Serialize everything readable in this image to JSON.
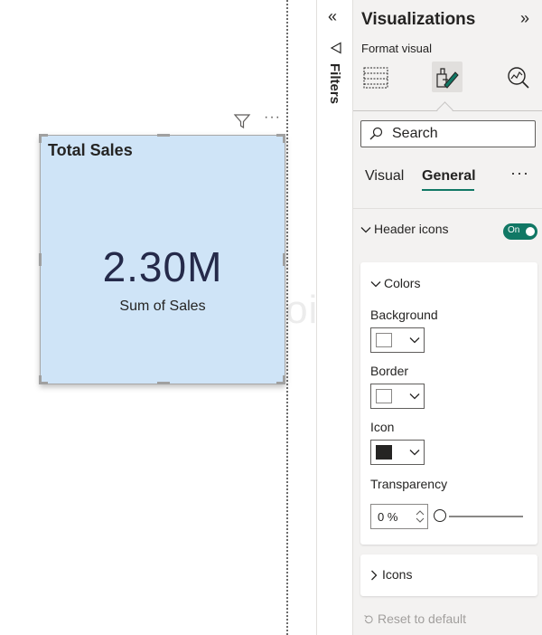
{
  "canvas": {
    "watermark": "javaTpoint",
    "card": {
      "title": "Total Sales",
      "value": "2.30M",
      "label": "Sum of Sales",
      "background": "#cfe4f7"
    },
    "header_icons": {
      "more": "···"
    }
  },
  "filters": {
    "collapse": "«",
    "label": "Filters"
  },
  "visualizations": {
    "title": "Visualizations",
    "expand": "»",
    "subtitle": "Format visual",
    "format_icons": [
      "build-visual-icon",
      "format-visual-icon",
      "analytics-icon"
    ],
    "search": {
      "placeholder": "Search"
    },
    "tabs": [
      {
        "label": "Visual",
        "active": false
      },
      {
        "label": "General",
        "active": true
      }
    ],
    "tab_more": "···",
    "header_icons": {
      "label": "Header icons",
      "toggle": "On",
      "accent": "#117865"
    },
    "colors_section": {
      "title": "Colors",
      "background_label": "Background",
      "background_color": "#ffffff",
      "border_label": "Border",
      "border_color": "#ffffff",
      "icon_label": "Icon",
      "icon_color": "#252423",
      "transparency_label": "Transparency",
      "transparency_value": "0 %",
      "transparency": 0
    },
    "icons_section": {
      "title": "Icons"
    },
    "reset": "Reset to default"
  }
}
